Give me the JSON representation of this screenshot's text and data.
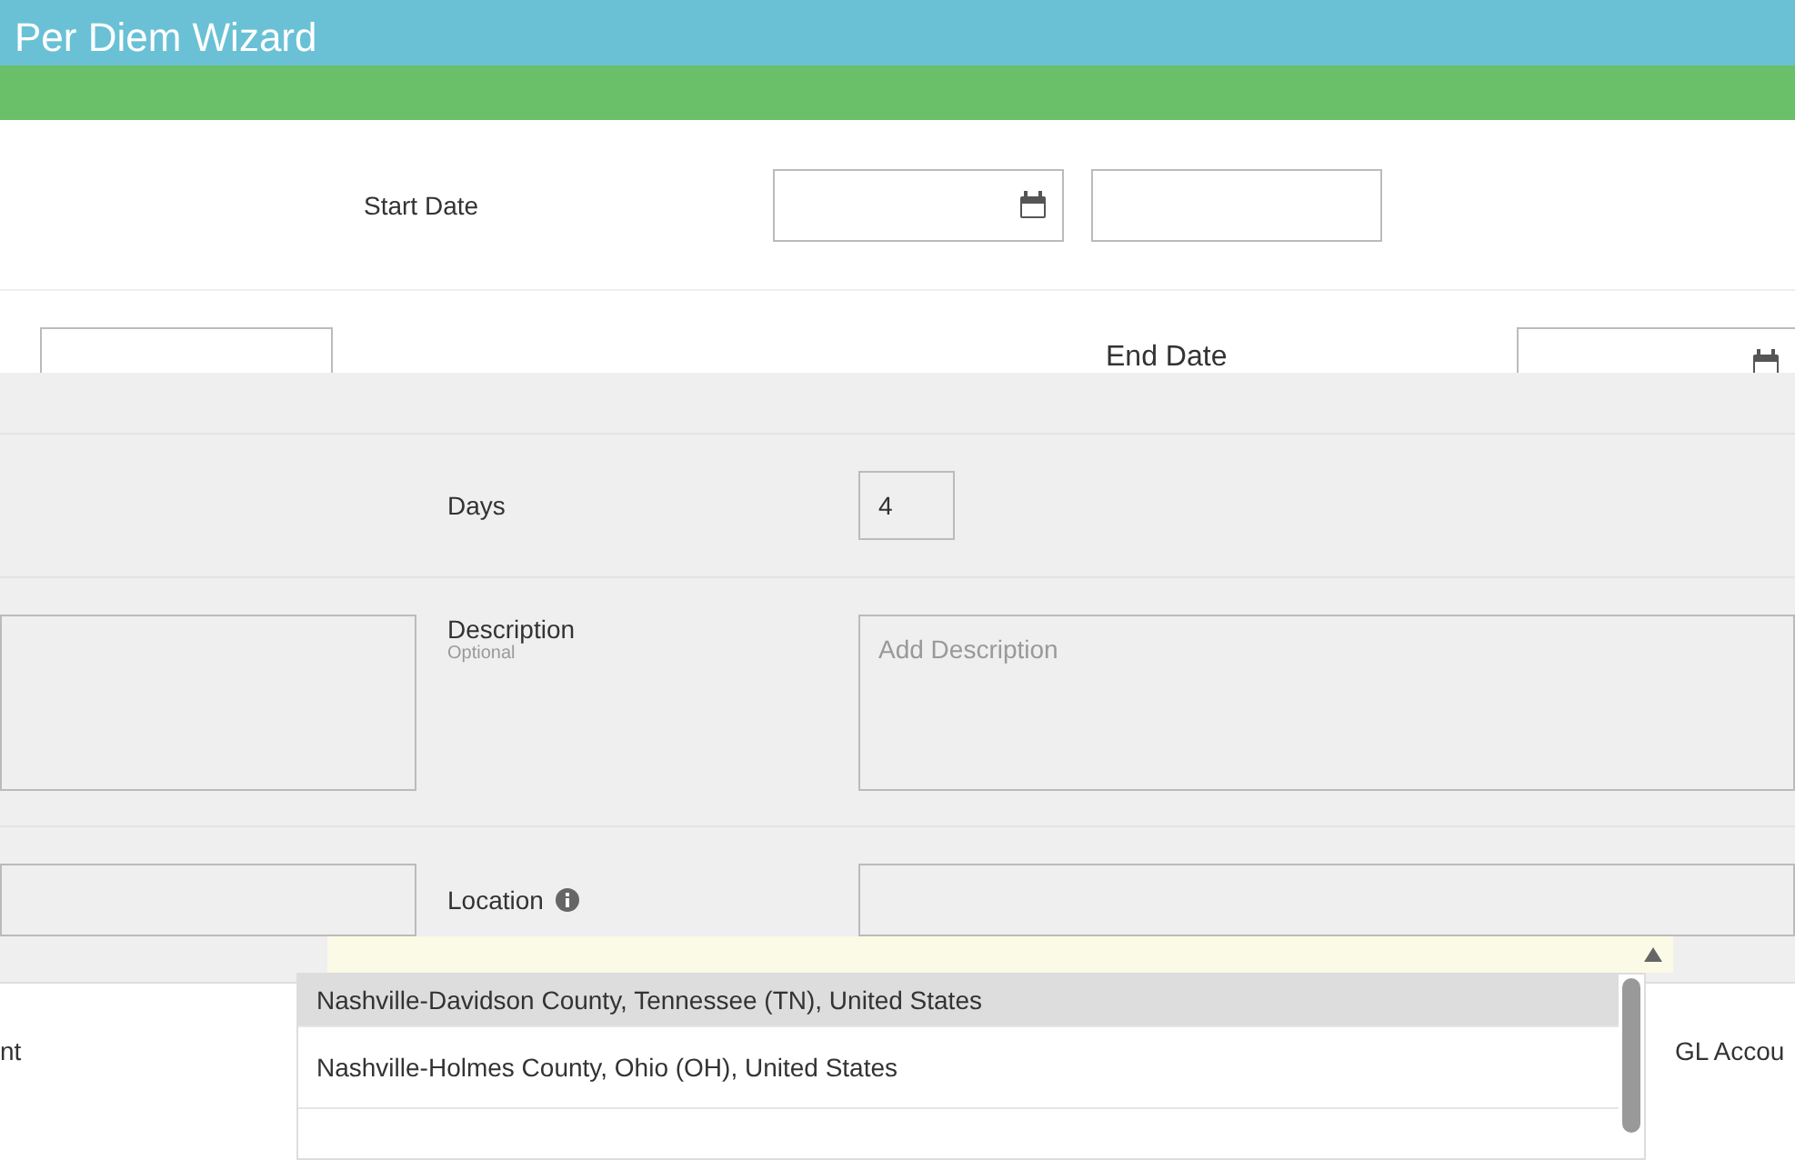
{
  "header": {
    "title": "Per Diem Wizard"
  },
  "start": {
    "label": "Start Date"
  },
  "end": {
    "label": "End Date"
  },
  "days": {
    "label": "Days",
    "value": "4"
  },
  "description": {
    "label": "Description",
    "hint": "Optional",
    "placeholder": "Add Description"
  },
  "location": {
    "label": "Location",
    "options": [
      {
        "label": "Nashville-Davidson County, Tennessee (TN), United States",
        "selected": true
      },
      {
        "label": "Nashville-Holmes County, Ohio (OH), United States",
        "selected": false
      }
    ]
  },
  "bottom_row": {
    "column_1": "nt",
    "column_3": "GL Accou"
  }
}
